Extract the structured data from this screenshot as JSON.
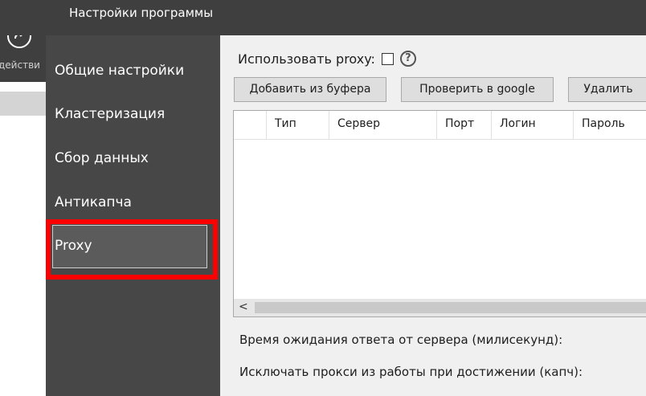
{
  "window": {
    "title": "Настройки программы"
  },
  "left_strip": {
    "label": "действи",
    "icon": "arrow-forward-circle-icon"
  },
  "sidebar": {
    "items": [
      {
        "label": "Общие настройки",
        "selected": false
      },
      {
        "label": "Кластеризация",
        "selected": false
      },
      {
        "label": "Сбор данных",
        "selected": false
      },
      {
        "label": "Антикапча",
        "selected": false
      },
      {
        "label": "Proxy",
        "selected": true
      }
    ],
    "highlight_color": "#ff0000"
  },
  "proxy": {
    "use_proxy_label": "Использовать proxy:",
    "use_proxy_checked": false,
    "help_glyph": "?",
    "buttons": {
      "add_from_clipboard": "Добавить из буфера",
      "check_google": "Проверить в google",
      "delete": "Удалить"
    },
    "table": {
      "columns": [
        "",
        "Тип",
        "Сервер",
        "Порт",
        "Логин",
        "Пароль"
      ],
      "rows": [],
      "scroll_left_glyph": "<"
    },
    "timeout_label": "Время ожидания ответа от сервера (милисекунд):",
    "exclude_label": "Исключать прокси из работы при достижении (капч):"
  },
  "colors": {
    "titlebar": "#3f3f3f",
    "sidebar": "#474747",
    "sidebar_selected": "#5b5b5b",
    "content_bg": "#f0f0f0"
  }
}
